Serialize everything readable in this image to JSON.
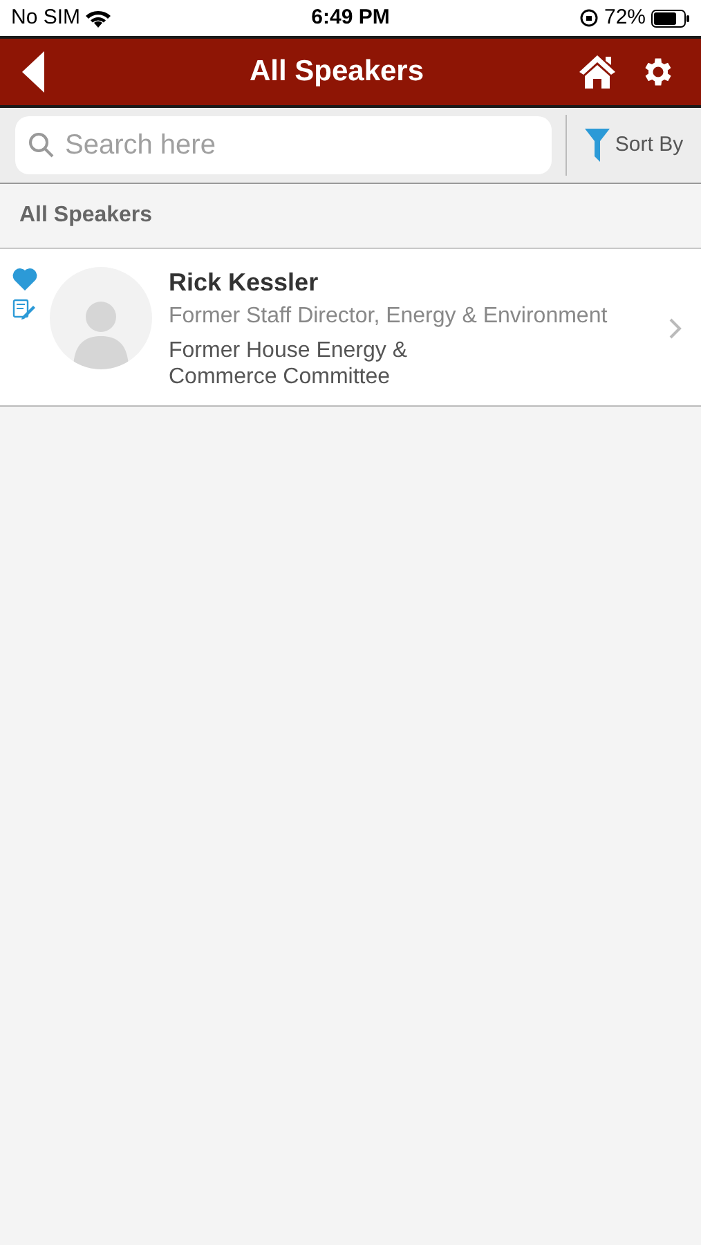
{
  "status_bar": {
    "carrier": "No SIM",
    "time": "6:49 PM",
    "battery": "72%"
  },
  "header": {
    "title": "All Speakers"
  },
  "search": {
    "placeholder": "Search here"
  },
  "sort_button": {
    "label": "Sort By"
  },
  "section": {
    "title": "All Speakers"
  },
  "speakers": [
    {
      "name": "Rick Kessler",
      "title": "Former Staff Director, Energy & Environment",
      "organization": "Former House Energy & Commerce Committee",
      "favorite": true,
      "has_notes": true
    }
  ]
}
